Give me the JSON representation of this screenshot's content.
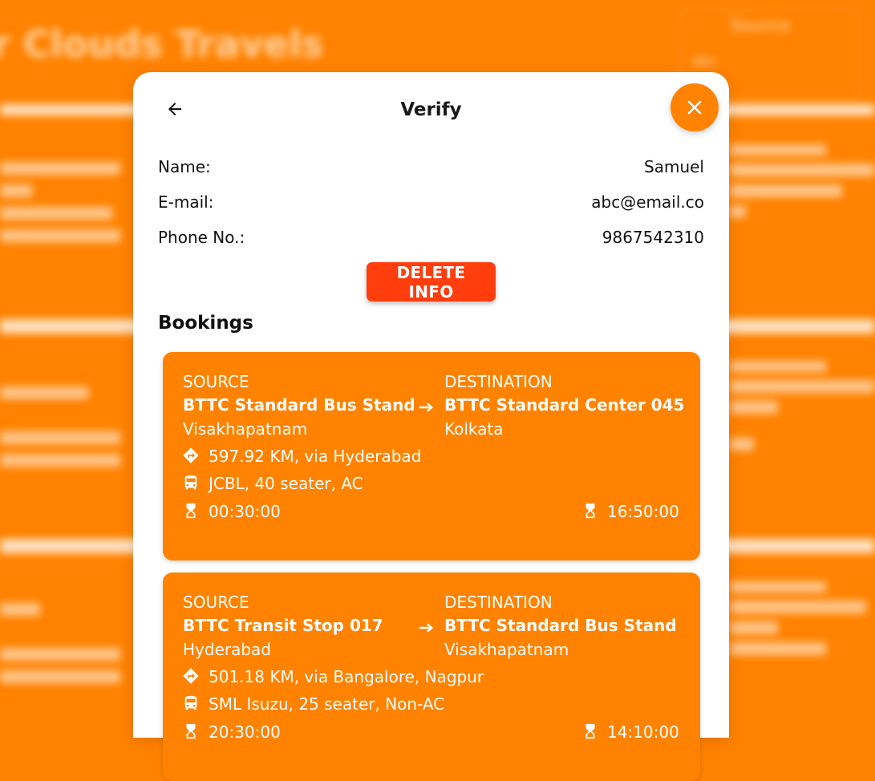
{
  "background": {
    "app_title": "r Clouds Travels",
    "search_label": "Source",
    "search_value": "abc"
  },
  "modal": {
    "title": "Verify",
    "user": {
      "name_label": "Name:",
      "name_value": "Samuel",
      "email_label": "E-mail:",
      "email_value": "abc@email.co",
      "phone_label": "Phone No.:",
      "phone_value": "9867542310"
    },
    "delete_label": "DELETE INFO",
    "bookings_title": "Bookings",
    "bookings": [
      {
        "source_label": "SOURCE",
        "source_name": "BTTC Standard Bus Stand",
        "source_city": "Visakhapatnam",
        "dest_label": "DESTINATION",
        "dest_name": "BTTC Standard Center 045",
        "dest_city": "Kolkata",
        "route": "597.92 KM, via Hyderabad",
        "bus": "JCBL, 40 seater, AC",
        "depart_time": "00:30:00",
        "arrive_time": "16:50:00"
      },
      {
        "source_label": "SOURCE",
        "source_name": "BTTC Transit Stop 017",
        "source_city": "Hyderabad",
        "dest_label": "DESTINATION",
        "dest_name": "BTTC Standard Bus Stand",
        "dest_city": "Visakhapatnam",
        "route": "501.18 KM, via Bangalore, Nagpur",
        "bus": "SML Isuzu, 25 seater, Non-AC",
        "depart_time": "20:30:00",
        "arrive_time": "14:10:00"
      }
    ]
  },
  "colors": {
    "accent": "#ff8200",
    "danger": "#ff3d0d",
    "surface": "#ffffff"
  }
}
